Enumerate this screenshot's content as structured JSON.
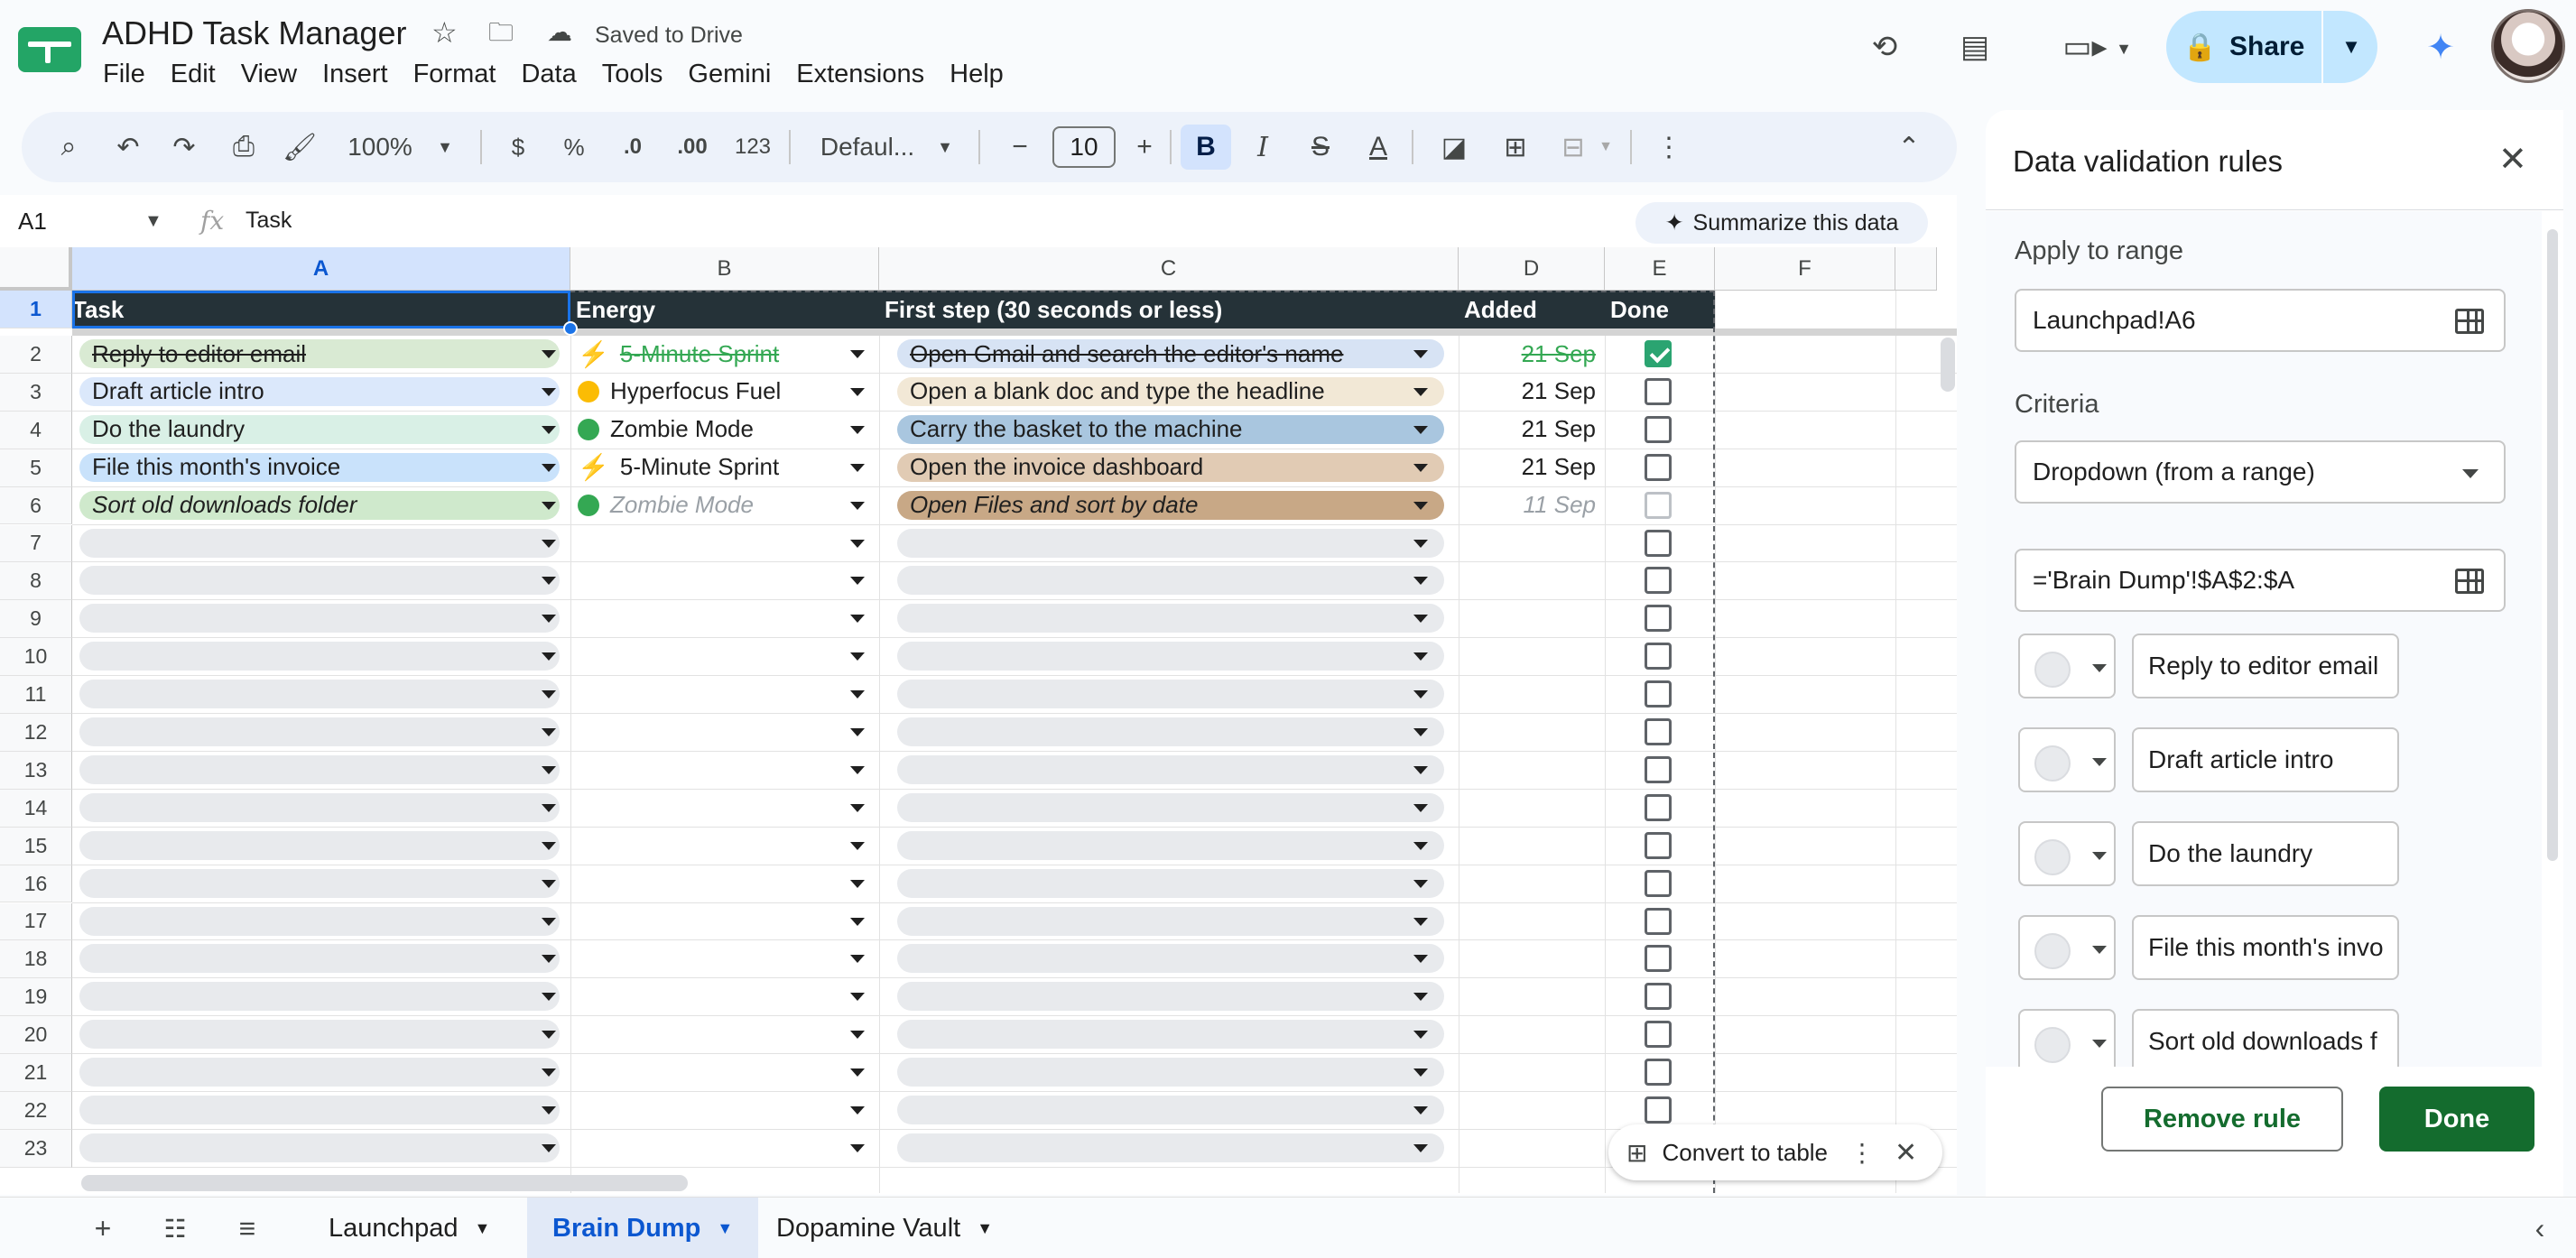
{
  "app": {
    "title": "ADHD Task Manager",
    "saved_status": "Saved to Drive",
    "share_label": "Share"
  },
  "menu": [
    "File",
    "Edit",
    "View",
    "Insert",
    "Format",
    "Data",
    "Tools",
    "Gemini",
    "Extensions",
    "Help"
  ],
  "toolbar": {
    "zoom": "100%",
    "currency": "$",
    "percent": "%",
    "dec_decrease": ".0",
    "dec_increase": ".00",
    "more_formats": "123",
    "font": "Defaul...",
    "font_size": "10",
    "bold": "B",
    "italic": "I",
    "text_color": "A"
  },
  "formula_bar": {
    "cell_ref": "A1",
    "fx": "fx",
    "value": "Task",
    "summarize_label": "Summarize this data"
  },
  "grid": {
    "columns": [
      "A",
      "B",
      "C",
      "D",
      "E",
      "F"
    ],
    "row_numbers": [
      "1",
      "2",
      "3",
      "4",
      "5",
      "6",
      "7",
      "8",
      "9",
      "10",
      "11",
      "12",
      "13",
      "14",
      "15",
      "16",
      "17",
      "18",
      "19",
      "20",
      "21",
      "22",
      "23"
    ],
    "headers": [
      "Task",
      "Energy",
      "First step (30 seconds or less)",
      "Added",
      "Done"
    ],
    "rows": [
      {
        "task": "Reply to editor email",
        "energy": "5-Minute Sprint",
        "step": "Open Gmail and search the editor's name",
        "added": "21 Sep",
        "done": true
      },
      {
        "task": "Draft article intro",
        "energy": "Hyperfocus Fuel",
        "step": "Open a blank doc and type the headline",
        "added": "21 Sep",
        "done": false
      },
      {
        "task": "Do the laundry",
        "energy": "Zombie Mode",
        "step": "Carry the basket to the machine",
        "added": "21 Sep",
        "done": false
      },
      {
        "task": "File this month's invoice",
        "energy": "5-Minute Sprint",
        "step": "Open the invoice dashboard",
        "added": "21 Sep",
        "done": false
      },
      {
        "task": "Sort old downloads folder",
        "energy": "Zombie Mode",
        "step": "Open Files and sort by date",
        "added": "11 Sep",
        "done": false
      }
    ],
    "colors": {
      "header_bg": "#253238",
      "chip_default": "#e8eaed",
      "done_green": "#34a853"
    }
  },
  "convert_pill": {
    "label": "Convert to table"
  },
  "sheets": {
    "tabs": [
      "Launchpad",
      "Brain Dump",
      "Dopamine Vault"
    ],
    "active": "Brain Dump"
  },
  "panel": {
    "title": "Data validation rules",
    "apply_label": "Apply to range",
    "apply_value": "Launchpad!A6",
    "criteria_label": "Criteria",
    "criteria_value": "Dropdown (from a range)",
    "range_value": "='Brain Dump'!$A$2:$A",
    "options": [
      "Reply to editor email",
      "Draft article intro",
      "Do the laundry",
      "File this month's invo",
      "Sort old downloads f"
    ],
    "remove_label": "Remove rule",
    "done_label": "Done",
    "accent": "#146c2e"
  }
}
